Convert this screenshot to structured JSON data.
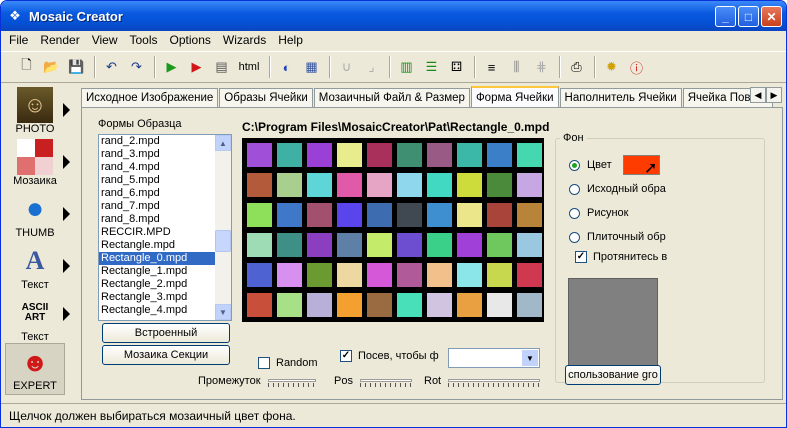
{
  "window": {
    "title": "Mosaic Creator",
    "minimize": "_",
    "maximize": "□",
    "close": "✕"
  },
  "menu": [
    "File",
    "Render",
    "View",
    "Tools",
    "Options",
    "Wizards",
    "Help"
  ],
  "toolbar": {
    "html_label": "html"
  },
  "left_panel": [
    {
      "label": "PHOTO",
      "icon": "mona-lisa-icon"
    },
    {
      "label": "Мозаика",
      "icon": "mosaic-icon"
    },
    {
      "label": "THUMB",
      "icon": "globe-icon"
    },
    {
      "label": "Текст",
      "icon": "letter-a-icon"
    },
    {
      "label": "Текст",
      "icon": "ascii-art-icon",
      "icon_text": "ASCII ART"
    },
    {
      "label": "EXPERT",
      "icon": "expert-face-icon"
    }
  ],
  "tabs": [
    "Исходное Изображение",
    "Образы Ячейки",
    "Мозаичный Файл & Размер",
    "Форма Ячейки",
    "Наполнитель Ячейки",
    "Ячейка Повыш"
  ],
  "active_tab": 3,
  "shapes": {
    "label": "Формы Образца",
    "items": [
      "rand_2.mpd",
      "rand_3.mpd",
      "rand_4.mpd",
      "rand_5.mpd",
      "rand_6.mpd",
      "rand_7.mpd",
      "rand_8.mpd",
      "RECCIR.MPD",
      "Rectangle.mpd",
      "Rectangle_0.mpd",
      "Rectangle_1.mpd",
      "Rectangle_2.mpd",
      "Rectangle_3.mpd",
      "Rectangle_4.mpd"
    ],
    "selected": 9,
    "builtin_button": "Встроенный",
    "section_button": "Мозаика Секции"
  },
  "file_path": "C:\\Program Files\\MosaicCreator\\Pat\\Rectangle_0.mpd",
  "mosaic_colors": [
    [
      "#9f4fd8",
      "#3fb0a4",
      "#9a40d6",
      "#e9ec8d",
      "#a8305a",
      "#3f8f72",
      "#9a5a86",
      "#3bb8a7",
      "#3a7fc8",
      "#45d8b0"
    ],
    [
      "#b25a3a",
      "#a8cf8e",
      "#5ed6d8",
      "#e159a9",
      "#e6a5c5",
      "#8fd7ec",
      "#41d9c2",
      "#cddc3a",
      "#4b8a3b",
      "#c6a6e3"
    ],
    [
      "#8ee05a",
      "#3f78c8",
      "#a34f6e",
      "#5a44ec",
      "#3e6cb0",
      "#404852",
      "#3e8fd0",
      "#ece68a",
      "#a8443a",
      "#b8843a"
    ],
    [
      "#9edcb6",
      "#3e8f86",
      "#8c3ec0",
      "#5e7fa6",
      "#c4ec6a",
      "#6e4ed0",
      "#3bd08a",
      "#a040d8",
      "#6ec85e",
      "#9ac8e0"
    ],
    [
      "#4e62d2",
      "#d890f0",
      "#6a9a30",
      "#ecd8a0",
      "#d458d8",
      "#b05a9a",
      "#f2c08a",
      "#8ae6e8",
      "#c8d84e",
      "#d03850"
    ],
    [
      "#c8503a",
      "#a8e088",
      "#b8b0d8",
      "#f4a030",
      "#9a6a40",
      "#48e0b8",
      "#d0c4e0",
      "#e8a040",
      "#e8e8e8",
      "#a0b8c8"
    ]
  ],
  "background": {
    "group_label": "Фон",
    "options": [
      "Цвет",
      "Исходный обра",
      "Рисунок",
      "Плиточный обр"
    ],
    "selected_option": 0,
    "stretch_label": "Протянитесь в",
    "stretch_checked": true,
    "color": "#ff3c00",
    "use_button": "спользование gro"
  },
  "controls": {
    "random_label": "Random",
    "random_checked": false,
    "sow_label": "Посев, чтобы ф",
    "sow_checked": true,
    "gap_label": "Промежуток",
    "pos_label": "Pos",
    "rot_label": "Rot"
  },
  "status": "Щелчок должен выбираться мозаичный цвет фона."
}
